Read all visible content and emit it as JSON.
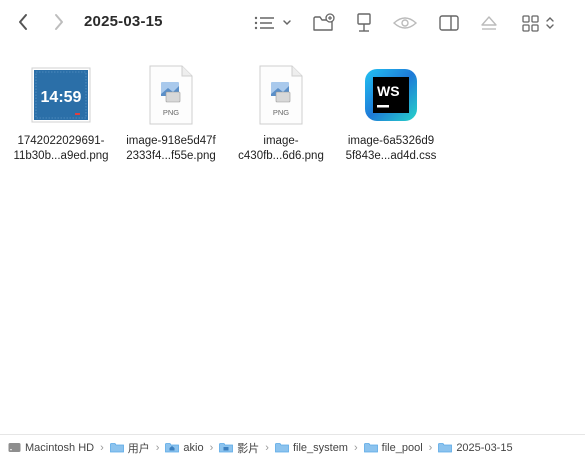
{
  "window": {
    "title": "2025-03-15"
  },
  "toolbar": {
    "back_icon": "chevron-left-icon",
    "forward_icon": "chevron-right-icon",
    "view_options_icon": "list-view-icon",
    "new_folder_icon": "new-folder-icon",
    "share_icon": "share-icon",
    "preview_icon": "eye-icon",
    "sidebar_icon": "sidebar-icon",
    "eject_icon": "eject-icon",
    "group_icon": "grid-view-icon"
  },
  "files": [
    {
      "name_line1": "1742022029691-",
      "name_line2": "11b30b...a9ed.png",
      "kind": "image-thumbnail",
      "preview_text": "14:59"
    },
    {
      "name_line1": "image-918e5d47f",
      "name_line2": "2333f4...f55e.png",
      "kind": "png-file",
      "badge": "PNG"
    },
    {
      "name_line1": "image-",
      "name_line2": "c430fb...6d6.png",
      "kind": "png-file",
      "badge": "PNG"
    },
    {
      "name_line1": "image-6a5326d9",
      "name_line2": "5f843e...ad4d.css",
      "kind": "webstorm-file",
      "badge": "WS"
    }
  ],
  "pathbar": {
    "items": [
      {
        "label": "Macintosh HD",
        "icon": "hard-drive-icon"
      },
      {
        "label": "用户",
        "icon": "folder-icon"
      },
      {
        "label": "akio",
        "icon": "home-folder-icon"
      },
      {
        "label": "影片",
        "icon": "movies-folder-icon"
      },
      {
        "label": "file_system",
        "icon": "folder-icon"
      },
      {
        "label": "file_pool",
        "icon": "folder-icon"
      },
      {
        "label": "2025-03-15",
        "icon": "folder-icon"
      }
    ],
    "separator": "›"
  },
  "colors": {
    "folder_blue": "#5aa9e6",
    "ws_blue": "#1e7ad8",
    "thumb_blue": "#2b6fa8"
  }
}
